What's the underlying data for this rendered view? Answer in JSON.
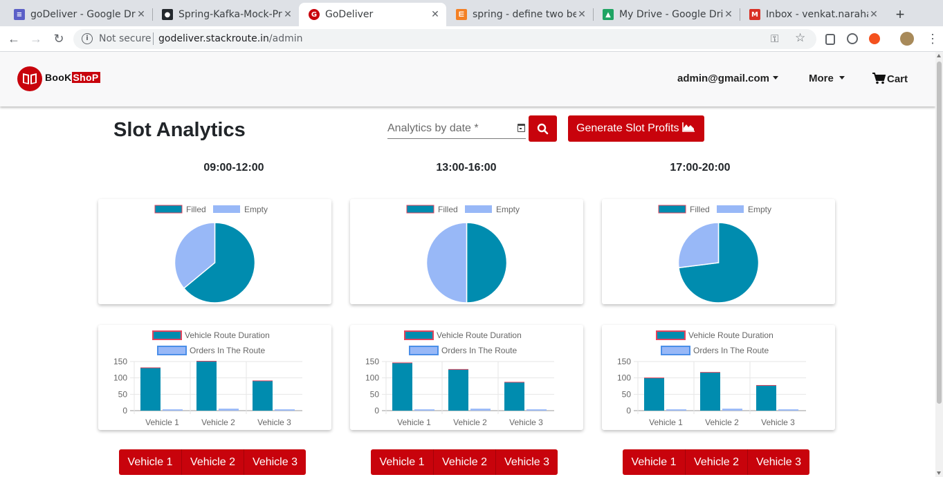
{
  "browser": {
    "tabs": [
      {
        "title": "goDeliver - Google Dr",
        "icon": "docs-icon",
        "color": "#5b5fc7"
      },
      {
        "title": "Spring-Kafka-Mock-Pr",
        "icon": "github-icon",
        "color": "#24292e"
      },
      {
        "title": "GoDeliver",
        "icon": "godeliver-icon",
        "color": "#c8030c"
      },
      {
        "title": "spring - define two be",
        "icon": "stackoverflow-icon",
        "color": "#f48024"
      },
      {
        "title": "My Drive - Google Driv",
        "icon": "drive-icon",
        "color": "#1fa463"
      },
      {
        "title": "Inbox - venkat.naraha",
        "icon": "gmail-icon",
        "color": "#d93025"
      }
    ],
    "security_label": "Not secure",
    "url_host": "godeliver.stackroute.in",
    "url_path": "/admin"
  },
  "navbar": {
    "brand_part1": "BooK",
    "brand_part2": "ShoP",
    "user": "admin@gmail.com",
    "more": "More",
    "cart": "Cart"
  },
  "toolbar": {
    "title": "Slot Analytics",
    "date_placeholder": "Analytics by date *",
    "generate_label": "Generate Slot Profits"
  },
  "slots": [
    {
      "label": "09:00-12:00",
      "pie": {
        "legend": [
          "Filled",
          "Empty"
        ],
        "values": [
          64,
          36
        ]
      },
      "bar": {
        "legend": [
          "Vehicle Route Duration",
          "Orders In The Route"
        ],
        "categories": [
          "Vehicle 1",
          "Vehicle 2",
          "Vehicle 3"
        ],
        "duration": [
          131,
          151,
          91
        ],
        "orders": [
          4,
          6,
          4
        ],
        "yticks": [
          "150",
          "100",
          "50",
          "0"
        ]
      },
      "buttons": [
        "Vehicle 1",
        "Vehicle 2",
        "Vehicle 3"
      ]
    },
    {
      "label": "13:00-16:00",
      "pie": {
        "legend": [
          "Filled",
          "Empty"
        ],
        "values": [
          50,
          50
        ]
      },
      "bar": {
        "legend": [
          "Vehicle Route Duration",
          "Orders In The Route"
        ],
        "categories": [
          "Vehicle 1",
          "Vehicle 2",
          "Vehicle 3"
        ],
        "duration": [
          146,
          126,
          87
        ],
        "orders": [
          4,
          6,
          4
        ],
        "yticks": [
          "150",
          "100",
          "50",
          "0"
        ]
      },
      "buttons": [
        "Vehicle 1",
        "Vehicle 2",
        "Vehicle 3"
      ]
    },
    {
      "label": "17:00-20:00",
      "pie": {
        "legend": [
          "Filled",
          "Empty"
        ],
        "values": [
          73,
          27
        ]
      },
      "bar": {
        "legend": [
          "Vehicle Route Duration",
          "Orders In The Route"
        ],
        "categories": [
          "Vehicle 1",
          "Vehicle 2",
          "Vehicle 3"
        ],
        "duration": [
          100,
          117,
          77
        ],
        "orders": [
          4,
          6,
          4
        ],
        "yticks": [
          "150",
          "100",
          "50",
          "0"
        ]
      },
      "buttons": [
        "Vehicle 1",
        "Vehicle 2",
        "Vehicle 3"
      ]
    }
  ],
  "colors": {
    "brand_red": "#c8030c",
    "filled": "#008caf",
    "empty": "#98b8f7",
    "duration_border": "#e4445d",
    "orders_border": "#4a8ee8"
  }
}
